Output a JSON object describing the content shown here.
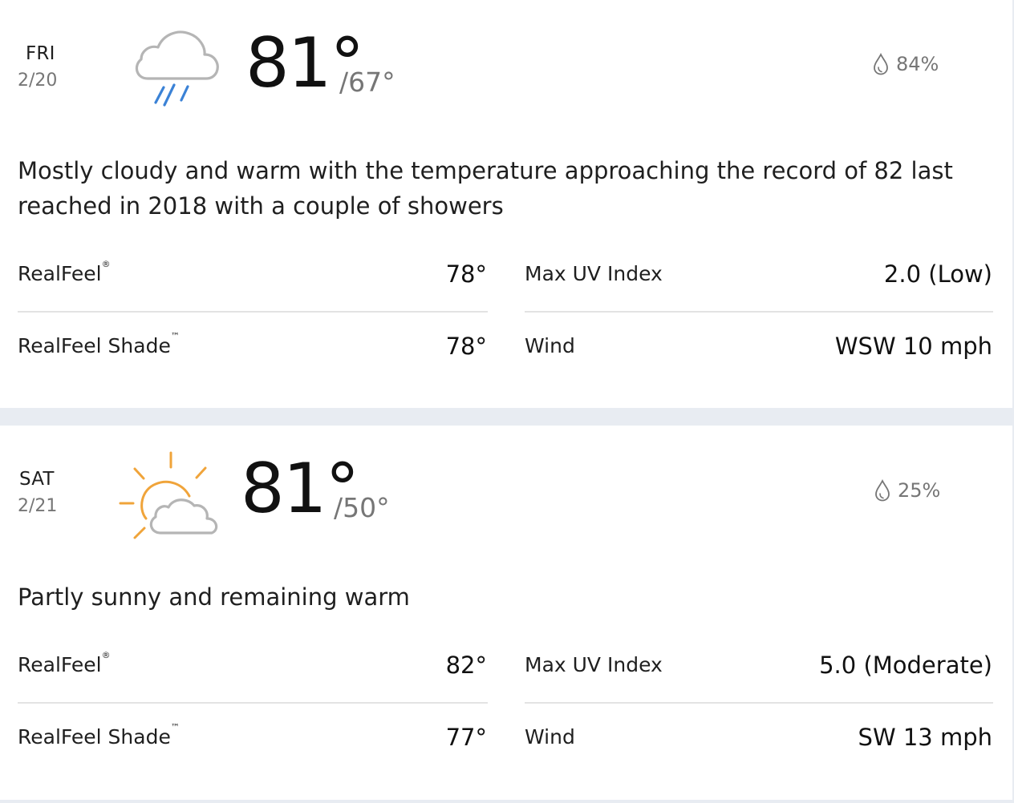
{
  "days": [
    {
      "dow": "FRI",
      "date": "2/20",
      "icon": "rain-cloud-icon",
      "high": "81°",
      "low": "/67°",
      "precip": "84%",
      "phrase": "Mostly cloudy and warm with the temperature approaching the record of 82 last reached in 2018 with a couple of showers",
      "realfeel_label": "RealFeel",
      "realfeel_mark": "®",
      "realfeel": "78°",
      "realfeel_shade_label": "RealFeel Shade",
      "realfeel_shade_mark": "™",
      "realfeel_shade": "78°",
      "uv_label": "Max UV Index",
      "uv": "2.0 (Low)",
      "wind_label": "Wind",
      "wind": "WSW 10 mph"
    },
    {
      "dow": "SAT",
      "date": "2/21",
      "icon": "partly-sunny-icon",
      "high": "81°",
      "low": "/50°",
      "precip": "25%",
      "phrase": "Partly sunny and remaining warm",
      "realfeel_label": "RealFeel",
      "realfeel_mark": "®",
      "realfeel": "82°",
      "realfeel_shade_label": "RealFeel Shade",
      "realfeel_shade_mark": "™",
      "realfeel_shade": "77°",
      "uv_label": "Max UV Index",
      "uv": "5.0 (Moderate)",
      "wind_label": "Wind",
      "wind": "SW 13 mph"
    }
  ],
  "colors": {
    "rain": "#3b82d6",
    "sun": "#f0a43a",
    "cloud": "#b5b5b5",
    "muted": "#767676",
    "divider": "#e3e3e3",
    "page_bg": "#e8ecf2"
  }
}
